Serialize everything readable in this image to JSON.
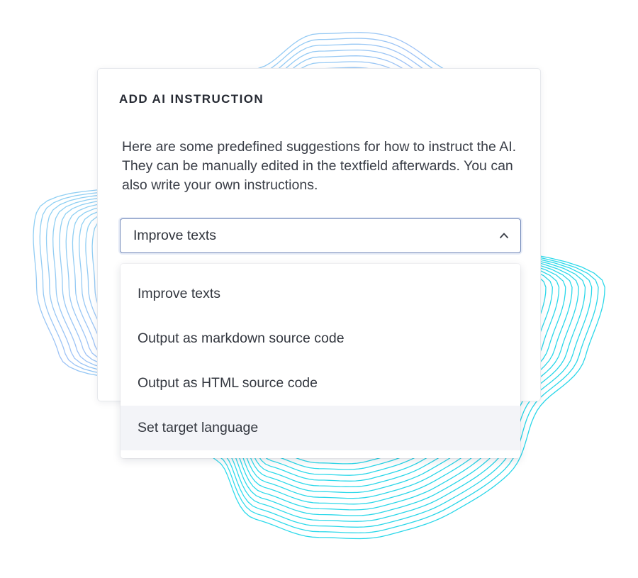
{
  "dialog": {
    "title": "ADD AI INSTRUCTION",
    "description": "Here are some predefined suggestions for how to instruct the AI. They can be manually edited in the textfield afterwards. You can also write your own instructions."
  },
  "select": {
    "value": "Improve texts",
    "expanded": true,
    "icon": "chevron-up-icon"
  },
  "dropdown": {
    "options": [
      {
        "label": "Improve texts"
      },
      {
        "label": "Output as markdown source code"
      },
      {
        "label": "Output as HTML source code"
      },
      {
        "label": "Set target language",
        "highlighted": true
      }
    ]
  },
  "colors": {
    "wave_cyan": "#2fd8ea",
    "wave_blue": "#8fb8f5",
    "focus_border": "#6f86b8",
    "highlight": "#f3f4f8"
  }
}
